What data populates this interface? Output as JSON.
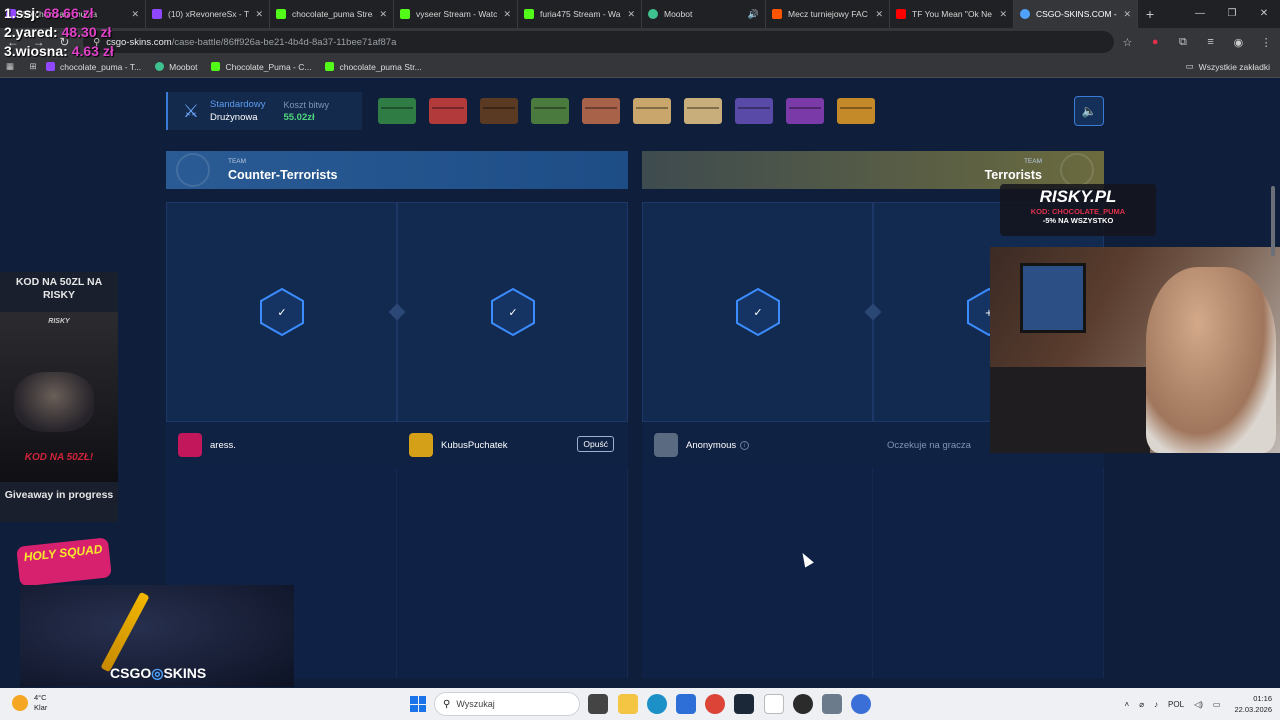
{
  "browser": {
    "tabs": [
      {
        "label": "(1) chocolate_puma",
        "color": "#9146ff",
        "active": false
      },
      {
        "label": "(10) xRevonereSx - Tw",
        "color": "#9146ff",
        "active": false
      },
      {
        "label": "chocolate_puma Strea",
        "color": "#53fc18",
        "active": false
      },
      {
        "label": "vyseer Stream - Watc",
        "color": "#53fc18",
        "active": false
      },
      {
        "label": "furia475 Stream - Wa",
        "color": "#53fc18",
        "active": false
      },
      {
        "label": "Moobot",
        "color": "#3ec28f",
        "active": false
      },
      {
        "label": "Mecz turniejowy FAC",
        "color": "#ff5500",
        "active": false
      },
      {
        "label": "TF You Mean \"Ok Ne",
        "color": "#ff0000",
        "active": false
      },
      {
        "label": "CSGO-SKINS.COM -",
        "color": "#4fa3ff",
        "active": true
      }
    ],
    "url_host": "csgo-skins.com",
    "url_path": "/case-battle/86ff926a-be21-4b4d-8a37-11bee71af87a",
    "bookmarks": [
      {
        "label": "chocolate_puma - T...",
        "color": "#9146ff"
      },
      {
        "label": "Moobot",
        "color": "#3ec28f"
      },
      {
        "label": "Chocolate_Puma - C...",
        "color": "#53fc18"
      },
      {
        "label": "chocolate_puma Str...",
        "color": "#53fc18"
      }
    ],
    "all_bookmarks": "Wszystkie zakładki"
  },
  "battle": {
    "mode_title": "Standardowy",
    "mode_sub": "Drużynowa",
    "cost_label": "Koszt bitwy",
    "cost_value": "55.02zł",
    "case_colors": [
      "#2f7d45",
      "#b23a3a",
      "#5a3a22",
      "#4a7a3e",
      "#a8624a",
      "#c9a66b",
      "#c7ae7a",
      "#5a4aa8",
      "#7a3aa8",
      "#c48a2a"
    ]
  },
  "teams": {
    "ct": {
      "small": "TEAM",
      "name": "Counter-Terrorists"
    },
    "t": {
      "small": "TEAM",
      "name": "Terrorists"
    }
  },
  "players": [
    {
      "name": "aress.",
      "avatar_color": "#c2185b"
    },
    {
      "name": "KubusPuchatek",
      "avatar_color": "#d4a017",
      "leave": "Opuść"
    },
    {
      "name": "Anonymous",
      "avatar_color": "#5a6a80",
      "info": "i"
    },
    {
      "waiting": "Oczekuje na gracza"
    }
  ],
  "overlay": {
    "scores": [
      {
        "label": "1.ssj:",
        "amount": "68.66 zł"
      },
      {
        "label": "2.yared:",
        "amount": "48.30 zł"
      },
      {
        "label": "3.wiosna:",
        "amount": "4.63 zł"
      }
    ],
    "promo_title": "KOD NA 50ZL NA RISKY",
    "promo_brand": "RISKY",
    "promo_code": "KOD NA 50ZŁ!",
    "giveaway": "Giveaway in progress",
    "holy_squad": "HOLY SQUAD",
    "csgo_logo_left": "CSGO",
    "csgo_logo_right": "SKINS",
    "risky_name": "RISKY.PL",
    "risky_code": "KOD: CHOCOLATE_PUMA",
    "risky_discount": "-5% NA WSZYSTKO"
  },
  "taskbar": {
    "temp": "4°C",
    "weather": "Klar",
    "search_placeholder": "Wyszukaj",
    "lang": "POL",
    "time": "01:16",
    "date": "22.03.2026"
  }
}
